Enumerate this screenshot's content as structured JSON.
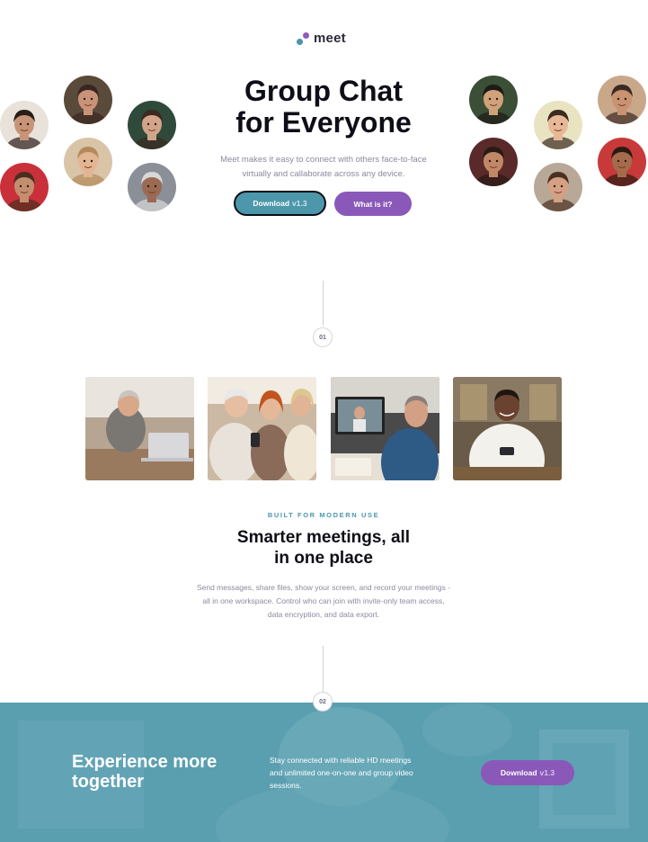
{
  "brand": {
    "name": "meet",
    "colors": {
      "teal": "#4d97aa",
      "purple": "#8a58b8",
      "dark": "#0e0e18"
    }
  },
  "hero": {
    "title_line1": "Group Chat",
    "title_line2": "for Everyone",
    "description_line1": "Meet makes it easy to connect with others face-to-face",
    "description_line2": "virtually and callaborate across any device.",
    "download_label": "Download",
    "download_version": "v1.3",
    "what_label": "What is it?"
  },
  "avatars": [
    {
      "icon": "person-avatar",
      "bg": "#e8e2da",
      "skin": "#c89478",
      "hair": "#2a1d18"
    },
    {
      "icon": "person-avatar",
      "bg": "#5a4a3a",
      "skin": "#c9937a",
      "hair": "#3a2620"
    },
    {
      "icon": "person-avatar",
      "bg": "#2f4a3a",
      "skin": "#d2a489",
      "hair": "#3b2a22"
    },
    {
      "icon": "person-avatar",
      "bg": "#c9303a",
      "skin": "#c38e6f",
      "hair": "#4a2e1e"
    },
    {
      "icon": "person-avatar",
      "bg": "#d9c4a8",
      "skin": "#e2b593",
      "hair": "#b48a5a"
    },
    {
      "icon": "person-avatar",
      "bg": "#8a8f98",
      "skin": "#9a6a52",
      "hair": "#d8d8d8"
    },
    {
      "icon": "person-avatar",
      "bg": "#3a4f35",
      "skin": "#d0a27a",
      "hair": "#1e1a18"
    },
    {
      "icon": "person-avatar",
      "bg": "#e8e4c2",
      "skin": "#e8b896",
      "hair": "#3a2a20"
    },
    {
      "icon": "person-avatar",
      "bg": "#c9a88a",
      "skin": "#c99270",
      "hair": "#3a2a22"
    },
    {
      "icon": "person-avatar",
      "bg": "#5a2a2a",
      "skin": "#c08866",
      "hair": "#2a1a14"
    },
    {
      "icon": "person-avatar",
      "bg": "#b8a898",
      "skin": "#d4a184",
      "hair": "#4a3020"
    },
    {
      "icon": "person-avatar",
      "bg": "#c83a3a",
      "skin": "#a46c4c",
      "hair": "#2a1a12"
    }
  ],
  "steps": {
    "one": "01",
    "two": "02"
  },
  "photos": [
    {
      "icon": "woman-laptop-photo",
      "bg": "#b7a594",
      "accent": "#e9e4de"
    },
    {
      "icon": "women-phone-photo",
      "bg": "#cbb9a3",
      "accent": "#f1ebe2"
    },
    {
      "icon": "video-call-laptop-photo",
      "bg": "#4a4a4a",
      "accent": "#2e5a86"
    },
    {
      "icon": "man-phone-photo",
      "bg": "#6a5a48",
      "accent": "#f3f1ec"
    }
  ],
  "features": {
    "eyebrow": "BUILT FOR MODERN USE",
    "title_line1": "Smarter meetings, all",
    "title_line2": "in one place",
    "desc_line1": "Send messages, share files, show your screen, and record your meetings -",
    "desc_line2": "all in one workspace. Control who can join with invite-only team access,",
    "desc_line3": "data encryption, and data export."
  },
  "band": {
    "title_line1": "Experience more",
    "title_line2": "together",
    "desc_line1": "Stay connected with reliable HD meetings",
    "desc_line2": "and unlimited one-on-one and group video",
    "desc_line3": "sessions.",
    "download_label": "Download",
    "download_version": "v1.3"
  }
}
